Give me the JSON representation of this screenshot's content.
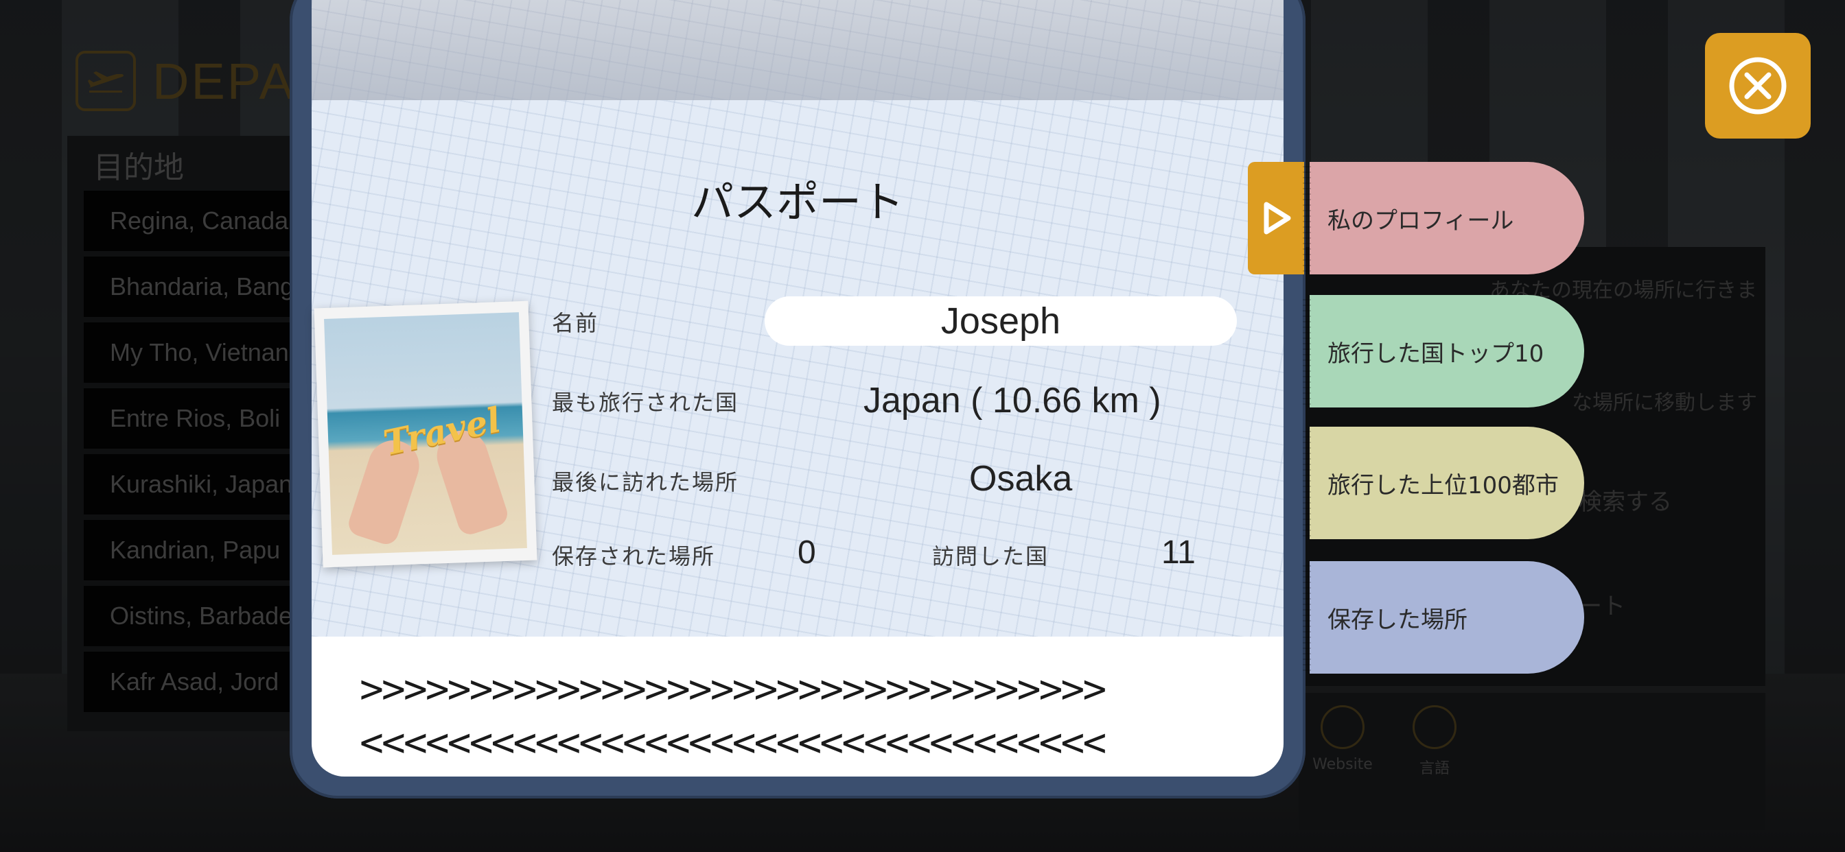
{
  "background": {
    "departures": {
      "title": "DEPA",
      "destination_label": "目的地",
      "items": [
        "Regina, Canada",
        "Bhandaria, Bang",
        "My Tho, Vietnan",
        "Entre Rios, Boli",
        "Kurashiki, Japan",
        "Kandrian, Papu",
        "Oistins, Barbade",
        "Kafr Asad, Jord"
      ]
    },
    "menu_items": [
      "あなたの現在の場所に行きま",
      "な場所に移動します",
      "検索する",
      "ート"
    ],
    "bottom_icons": [
      {
        "label": "Website",
        "icon": "website-globe-icon"
      },
      {
        "label": "言語",
        "icon": "language-globe-icon"
      }
    ]
  },
  "passport": {
    "title": "パスポート",
    "name_label": "名前",
    "name_value": "Joseph",
    "most_traveled_label": "最も旅行された国",
    "most_traveled_value": "Japan ( 10.66 km )",
    "last_visited_label": "最後に訪れた場所",
    "last_visited_value": "Osaka",
    "saved_places_label": "保存された場所",
    "saved_places_value": "0",
    "visited_countries_label": "訪問した国",
    "visited_countries_value": "11",
    "photo_text": "Travel",
    "mrz_line1": ">>>>>>>>>>>>>>>>>>>>>>>>>>>>>>>>>>",
    "mrz_line2": "<<<<<<<<<<<<<<<<<<<<<<<<<<<<<<<<<<"
  },
  "tabs": [
    {
      "label": "私のプロフィール",
      "color": "#dba5a8"
    },
    {
      "label": "旅行した国トップ10",
      "color": "#a9d7b8"
    },
    {
      "label": "旅行した上位100都市",
      "color": "#d8d6a5"
    },
    {
      "label": "保存した場所",
      "color": "#a9b5d8"
    }
  ],
  "colors": {
    "accent": "#dc9d22",
    "passport_cover": "#3b4f6f"
  }
}
